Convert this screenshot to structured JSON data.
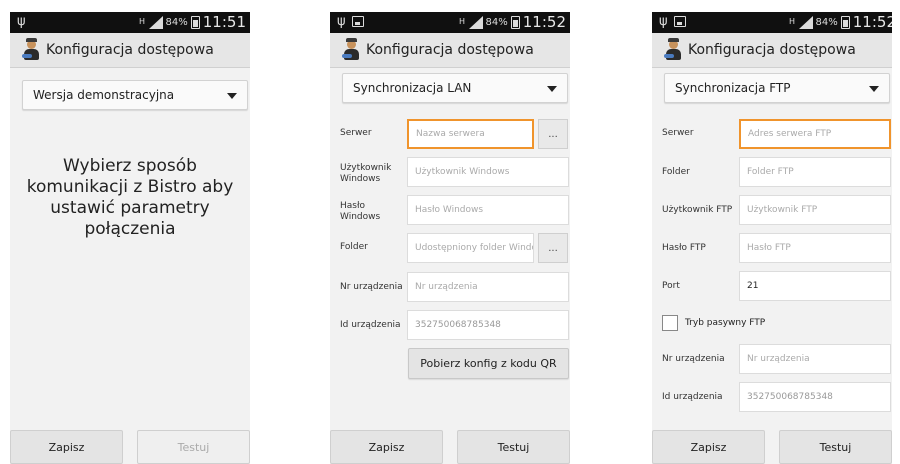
{
  "screens": [
    {
      "status": {
        "battery_pct": "84%",
        "time": "11:51",
        "net": "H"
      },
      "title": "Konfiguracja dostępowa",
      "dropdown": "Wersja demonstracyjna",
      "message": "Wybierz sposób komunikacji z Bistro aby ustawić parametry połączenia",
      "save": "Zapisz",
      "test": "Testuj"
    },
    {
      "status": {
        "battery_pct": "84%",
        "time": "11:52",
        "net": "H"
      },
      "title": "Konfiguracja dostępowa",
      "dropdown": "Synchronizacja LAN",
      "server_label": "Serwer",
      "server_placeholder": "Nazwa serwera",
      "browse": "...",
      "user_label": "Użytkownik Windows",
      "user_placeholder": "Użytkownik Windows",
      "pass_label": "Hasło Windows",
      "pass_placeholder": "Hasło Windows",
      "folder_label": "Folder",
      "folder_placeholder": "Udostępniony folder Windows",
      "device_no_label": "Nr urządzenia",
      "device_no_placeholder": "Nr urządzenia",
      "device_id_label": "Id urządzenia",
      "device_id_value": "352750068785348",
      "qr_button": "Pobierz konfig z kodu QR",
      "save": "Zapisz",
      "test": "Testuj"
    },
    {
      "status": {
        "battery_pct": "84%",
        "time": "11:52",
        "net": "H"
      },
      "title": "Konfiguracja dostępowa",
      "dropdown": "Synchronizacja FTP",
      "server_label": "Serwer",
      "server_placeholder": "Adres serwera FTP",
      "folder_label": "Folder",
      "folder_placeholder": "Folder FTP",
      "user_label": "Użytkownik FTP",
      "user_placeholder": "Użytkownik FTP",
      "pass_label": "Hasło FTP",
      "pass_placeholder": "Hasło FTP",
      "port_label": "Port",
      "port_value": "21",
      "passive_label": "Tryb pasywny FTP",
      "device_no_label": "Nr urządzenia",
      "device_no_placeholder": "Nr urządzenia",
      "device_id_label": "Id urządzenia",
      "device_id_value": "352750068785348",
      "save": "Zapisz",
      "test": "Testuj"
    }
  ],
  "colors": {
    "focus_border": "#f0942c",
    "status_bar": "#101010",
    "action_bar": "#e6e6e6"
  }
}
